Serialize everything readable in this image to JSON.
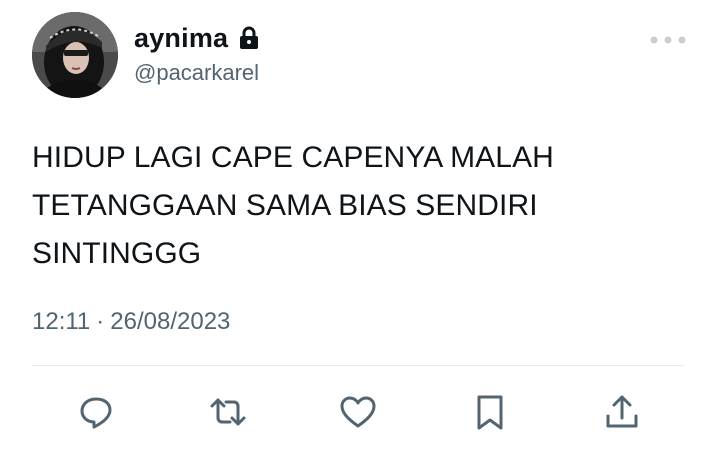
{
  "user": {
    "display_name": "aynima",
    "handle": "@pacarkarel",
    "avatar_icon": "profile-photo",
    "protected_icon": "lock-icon"
  },
  "tweet": {
    "text": "HIDUP LAGI CAPE CAPENYA MALAH\nTETANGGAAN SAMA BIAS SENDIRI\nSINTINGGG",
    "time": "12:11",
    "separator": "·",
    "date": "26/08/2023"
  },
  "actions": [
    {
      "name": "reply",
      "icon": "reply-icon"
    },
    {
      "name": "retweet",
      "icon": "retweet-icon"
    },
    {
      "name": "like",
      "icon": "heart-icon"
    },
    {
      "name": "bookmark",
      "icon": "bookmark-icon"
    },
    {
      "name": "share",
      "icon": "share-icon"
    }
  ],
  "colors": {
    "text_primary": "#0f1419",
    "text_secondary": "#536471",
    "divider": "#e6ecf0"
  }
}
